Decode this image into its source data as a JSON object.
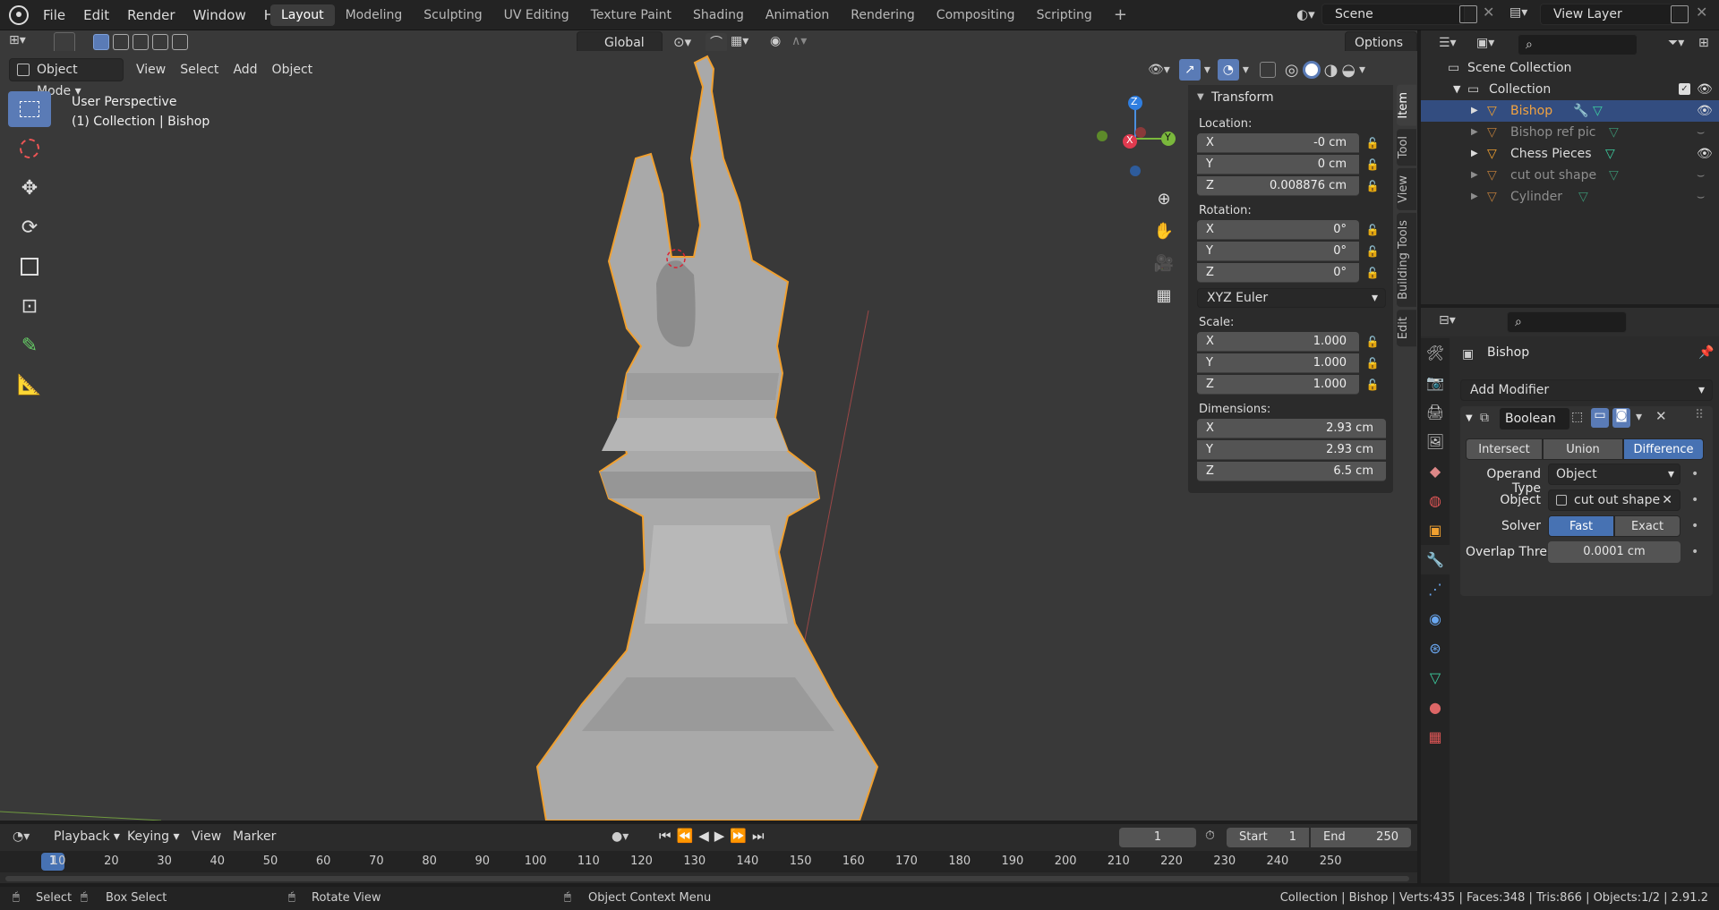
{
  "menu": {
    "items": [
      "File",
      "Edit",
      "Render",
      "Window",
      "Help"
    ]
  },
  "workspaces": [
    "Layout",
    "Modeling",
    "Sculpting",
    "UV Editing",
    "Texture Paint",
    "Shading",
    "Animation",
    "Rendering",
    "Compositing",
    "Scripting"
  ],
  "workspace_add": "+",
  "scene": {
    "name": "Scene",
    "view_layer": "View Layer"
  },
  "header": {
    "transform_orientation": "Global",
    "options": "Options"
  },
  "viewport": {
    "mode": "Object Mode",
    "menus": [
      "View",
      "Select",
      "Add",
      "Object"
    ],
    "perspective": "User Perspective",
    "context": "(1) Collection | Bishop",
    "gizmo": {
      "z": "Z",
      "y": "Y",
      "x": "X"
    }
  },
  "npanel": {
    "title": "Transform",
    "location_label": "Location:",
    "location": [
      {
        "axis": "X",
        "value": "-0 cm"
      },
      {
        "axis": "Y",
        "value": "0 cm"
      },
      {
        "axis": "Z",
        "value": "0.008876 cm"
      }
    ],
    "rotation_label": "Rotation:",
    "rotation": [
      {
        "axis": "X",
        "value": "0°"
      },
      {
        "axis": "Y",
        "value": "0°"
      },
      {
        "axis": "Z",
        "value": "0°"
      }
    ],
    "rotation_mode": "XYZ Euler",
    "scale_label": "Scale:",
    "scale": [
      {
        "axis": "X",
        "value": "1.000"
      },
      {
        "axis": "Y",
        "value": "1.000"
      },
      {
        "axis": "Z",
        "value": "1.000"
      }
    ],
    "dimensions_label": "Dimensions:",
    "dimensions": [
      {
        "axis": "X",
        "value": "2.93 cm"
      },
      {
        "axis": "Y",
        "value": "2.93 cm"
      },
      {
        "axis": "Z",
        "value": "6.5 cm"
      }
    ],
    "side_tabs": [
      "Item",
      "Tool",
      "View",
      "Building Tools",
      "Edit"
    ]
  },
  "outliner": {
    "root": "Scene Collection",
    "collection": "Collection",
    "items": [
      {
        "name": "Bishop",
        "selected": true,
        "dim": false
      },
      {
        "name": "Bishop ref pic",
        "selected": false,
        "dim": true
      },
      {
        "name": "Chess Pieces",
        "selected": false,
        "dim": false
      },
      {
        "name": "cut out shape",
        "selected": false,
        "dim": true
      },
      {
        "name": "Cylinder",
        "selected": false,
        "dim": true
      }
    ]
  },
  "properties": {
    "object": "Bishop",
    "add_modifier": "Add Modifier",
    "modifier_name": "Boolean",
    "ops": [
      "Intersect",
      "Union",
      "Difference"
    ],
    "active_op": "Difference",
    "operand_type_label": "Operand Type",
    "operand_type": "Object",
    "object_label": "Object",
    "object_value": "cut out shape",
    "solver_label": "Solver",
    "solvers": [
      "Fast",
      "Exact"
    ],
    "active_solver": "Fast",
    "overlap_label": "Overlap Thre...",
    "overlap_value": "0.0001 cm"
  },
  "timeline": {
    "menus": [
      "Playback",
      "Keying",
      "View",
      "Marker"
    ],
    "current_frame": "1",
    "start_label": "Start",
    "start": "1",
    "end_label": "End",
    "end": "250",
    "ticks": [
      "1",
      "10",
      "20",
      "30",
      "40",
      "50",
      "60",
      "70",
      "80",
      "90",
      "100",
      "110",
      "120",
      "130",
      "140",
      "150",
      "160",
      "170",
      "180",
      "190",
      "200",
      "210",
      "220",
      "230",
      "240",
      "250"
    ]
  },
  "statusbar": {
    "select": "Select",
    "box_select": "Box Select",
    "rotate_view": "Rotate View",
    "context_menu": "Object Context Menu",
    "stats": "Collection | Bishop | Verts:435 | Faces:348 | Tris:866 | Objects:1/2 | 2.91.2"
  },
  "colors": {
    "accent": "#4772b3",
    "selection_outline": "#f0a030",
    "viewport_bg": "#393939"
  }
}
